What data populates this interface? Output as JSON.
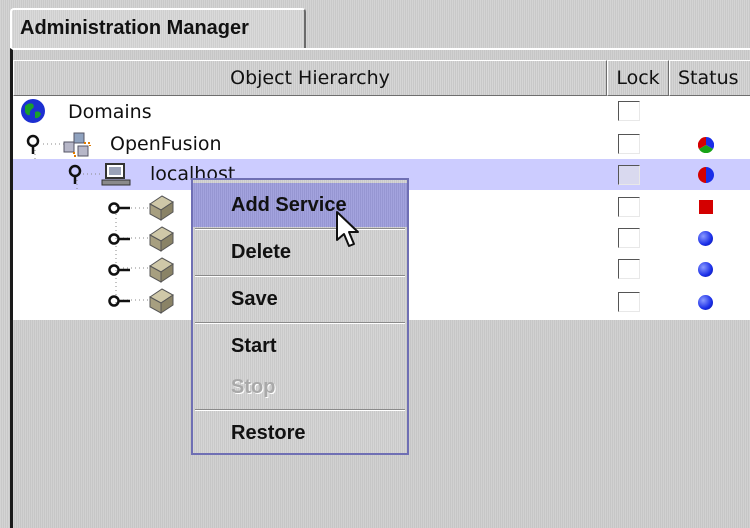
{
  "tab": {
    "label": "Administration Manager"
  },
  "table": {
    "columns": {
      "hierarchy": "Object Hierarchy",
      "lock": "Lock",
      "status": "Status"
    },
    "rows": [
      {
        "label": "Domains",
        "icon": "globe-icon",
        "locked": false
      },
      {
        "label": "OpenFusion",
        "icon": "network-icon",
        "locked": false,
        "status_color": "multi"
      },
      {
        "label": "localhost",
        "icon": "computer-icon",
        "locked": false,
        "status_color": "multi",
        "selected": true
      },
      {
        "label": "",
        "icon": "service-icon",
        "locked": false,
        "status_color": "#d40000"
      },
      {
        "label": "",
        "icon": "service-icon",
        "locked": false,
        "status_color": "#1a2ee8"
      },
      {
        "label": "",
        "icon": "service-icon",
        "locked": false,
        "status_color": "#1a2ee8"
      },
      {
        "label": "",
        "icon": "service-icon",
        "locked": false,
        "status_color": "#1a2ee8"
      }
    ]
  },
  "context_menu": {
    "items": [
      {
        "label": "Add Service",
        "highlighted": true,
        "enabled": true
      },
      {
        "label": "Delete",
        "enabled": true
      },
      {
        "label": "Save",
        "enabled": true
      },
      {
        "label": "Start",
        "enabled": true
      },
      {
        "label": "Stop",
        "enabled": false
      },
      {
        "label": "Restore",
        "enabled": true
      }
    ]
  },
  "colors": {
    "selection": "#ccccff",
    "menu_highlight": "#9c9cd8",
    "menu_border": "#6f6fb4"
  }
}
